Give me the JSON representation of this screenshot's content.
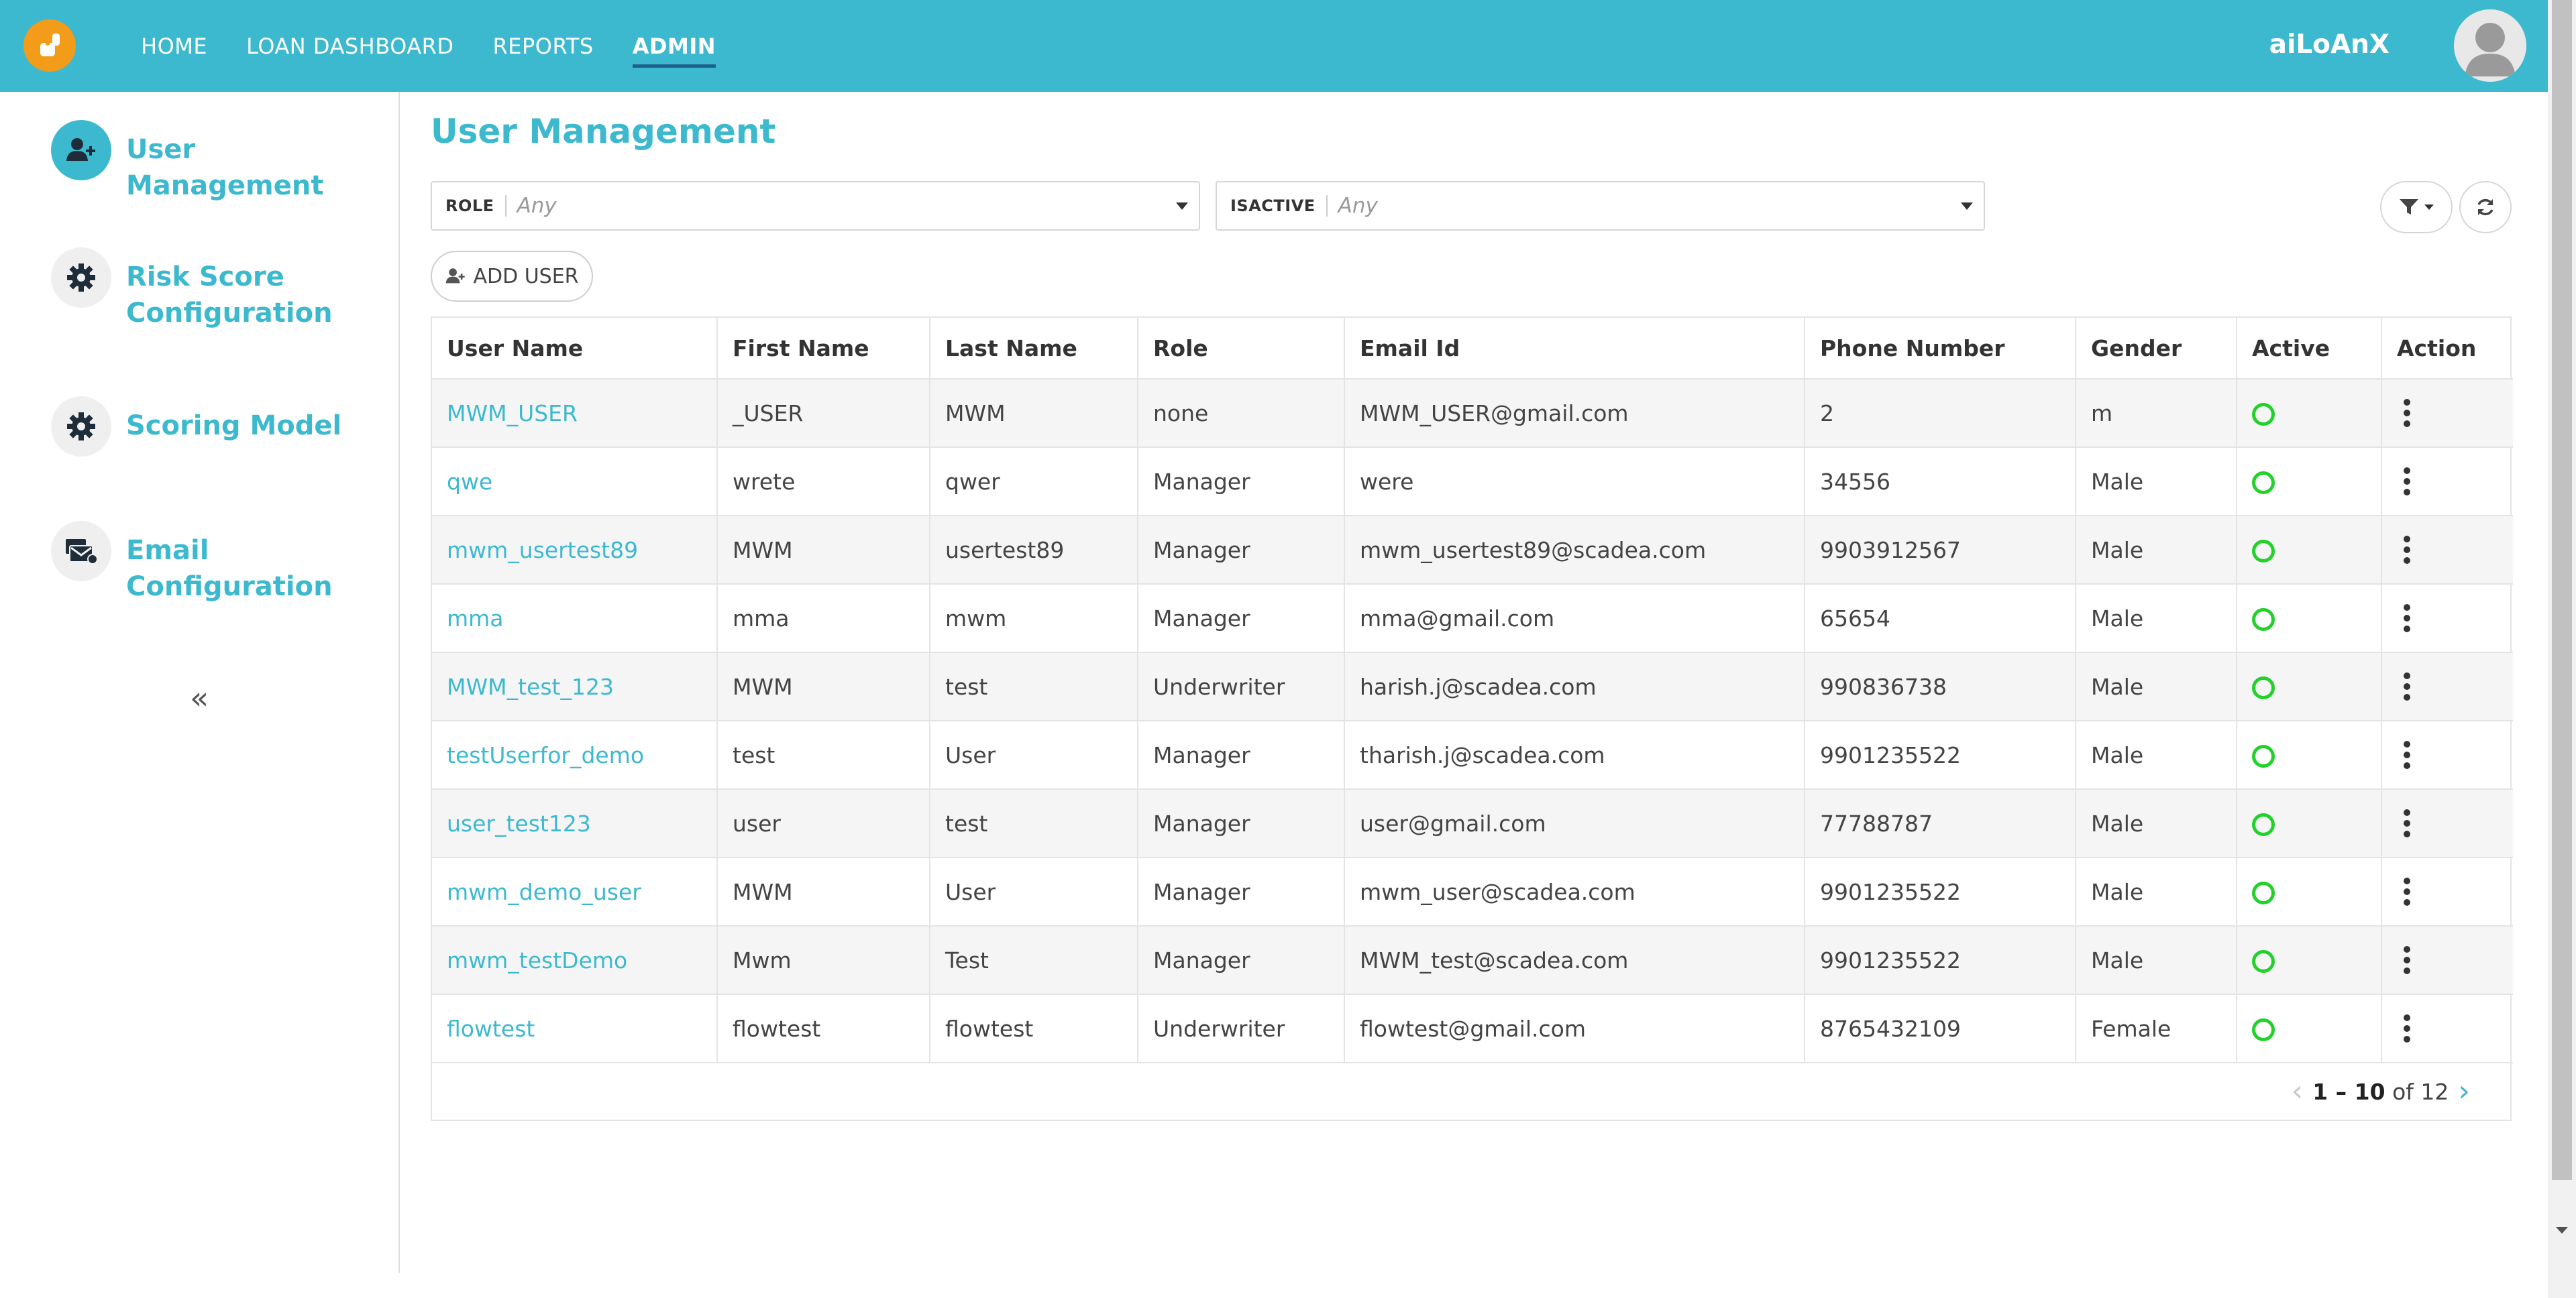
{
  "app": {
    "brand": "aiLoAnX"
  },
  "nav": [
    {
      "label": "HOME",
      "active": false
    },
    {
      "label": "LOAN DASHBOARD",
      "active": false
    },
    {
      "label": "REPORTS",
      "active": false
    },
    {
      "label": "ADMIN",
      "active": true
    }
  ],
  "sidebar": {
    "items": [
      {
        "label": "User Management",
        "icon": "user-plus-icon",
        "active": true
      },
      {
        "label": "Risk Score Configuration",
        "icon": "gear-icon",
        "active": false
      },
      {
        "label": "Scoring Model",
        "icon": "gear-icon",
        "active": false
      },
      {
        "label": "Email Configuration",
        "icon": "email-settings-icon",
        "active": false
      }
    ],
    "collapse_label": "«"
  },
  "main": {
    "title": "User Management",
    "filters": {
      "role": {
        "label": "ROLE",
        "value": "Any"
      },
      "isactive": {
        "label": "ISACTIVE",
        "value": "Any"
      }
    },
    "add_user_label": "ADD USER"
  },
  "table": {
    "columns": [
      "User Name",
      "First Name",
      "Last Name",
      "Role",
      "Email Id",
      "Phone Number",
      "Gender",
      "Active",
      "Action"
    ],
    "rows": [
      [
        "MWM_USER",
        "_USER",
        "MWM",
        "none",
        "MWM_USER@gmail.com",
        "2",
        "m"
      ],
      [
        "qwe",
        "wrete",
        "qwer",
        "Manager",
        "were",
        "34556",
        "Male"
      ],
      [
        "mwm_usertest89",
        "MWM",
        "usertest89",
        "Manager",
        "mwm_usertest89@scadea.com",
        "9903912567",
        "Male"
      ],
      [
        "mma",
        "mma",
        "mwm",
        "Manager",
        "mma@gmail.com",
        "65654",
        "Male"
      ],
      [
        "MWM_test_123",
        "MWM",
        "test",
        "Underwriter",
        "harish.j@scadea.com",
        "990836738",
        "Male"
      ],
      [
        "testUserfor_demo",
        "test",
        "User",
        "Manager",
        "tharish.j@scadea.com",
        "9901235522",
        "Male"
      ],
      [
        "user_test123",
        "user",
        "test",
        "Manager",
        "user@gmail.com",
        "77788787",
        "Male"
      ],
      [
        "mwm_demo_user",
        "MWM",
        "User",
        "Manager",
        "mwm_user@scadea.com",
        "9901235522",
        "Male"
      ],
      [
        "mwm_testDemo",
        "Mwm",
        "Test",
        "Manager",
        "MWM_test@scadea.com",
        "9901235522",
        "Male"
      ],
      [
        "flowtest",
        "flowtest",
        "flowtest",
        "Underwriter",
        "flowtest@gmail.com",
        "8765432109",
        "Female"
      ]
    ],
    "active_color": "#22d12a"
  },
  "pagination": {
    "range": "1 – 10",
    "of_label": "of",
    "total": "12"
  },
  "colors": {
    "accent": "#3db9cf",
    "logo": "#f39c1a",
    "nav_underline": "#1d5f8f"
  }
}
